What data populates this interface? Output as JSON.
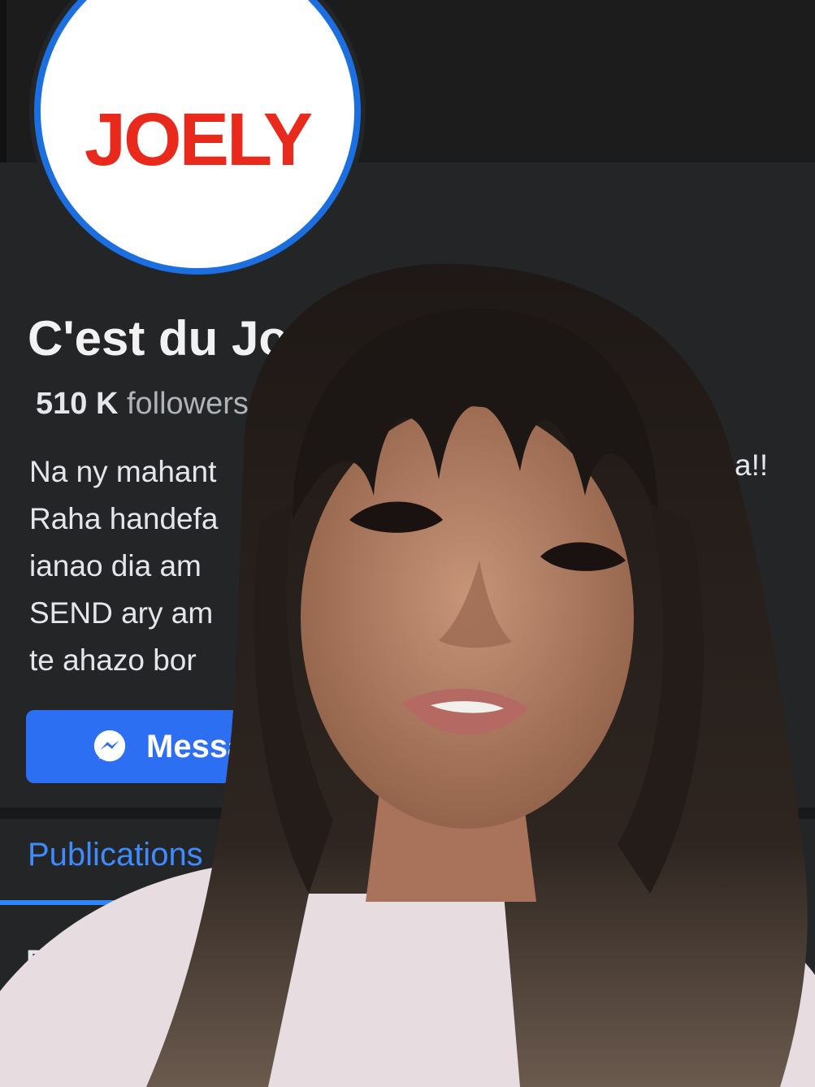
{
  "cover": {
    "text": ""
  },
  "avatar": {
    "logo_text": "JOELY"
  },
  "page": {
    "name": "C'est du Joel",
    "followers_count": "510 K",
    "followers_label": "followers"
  },
  "bio": {
    "lines": [
      "Na ny mahant",
      "Raha handefa",
      "ianao dia am",
      "SEND ary am",
      "te ahazo bor"
    ],
    "line_end_fragment": "a!!"
  },
  "buttons": {
    "message_label": "Messa"
  },
  "tabs": {
    "publications": "Publications"
  },
  "section": {
    "heading": "Dé"
  },
  "colors": {
    "accent": "#2d6ff2",
    "logo_red": "#e8291c",
    "background": "#242526"
  },
  "icons": {
    "message": "messenger-icon",
    "info": "info-icon"
  }
}
